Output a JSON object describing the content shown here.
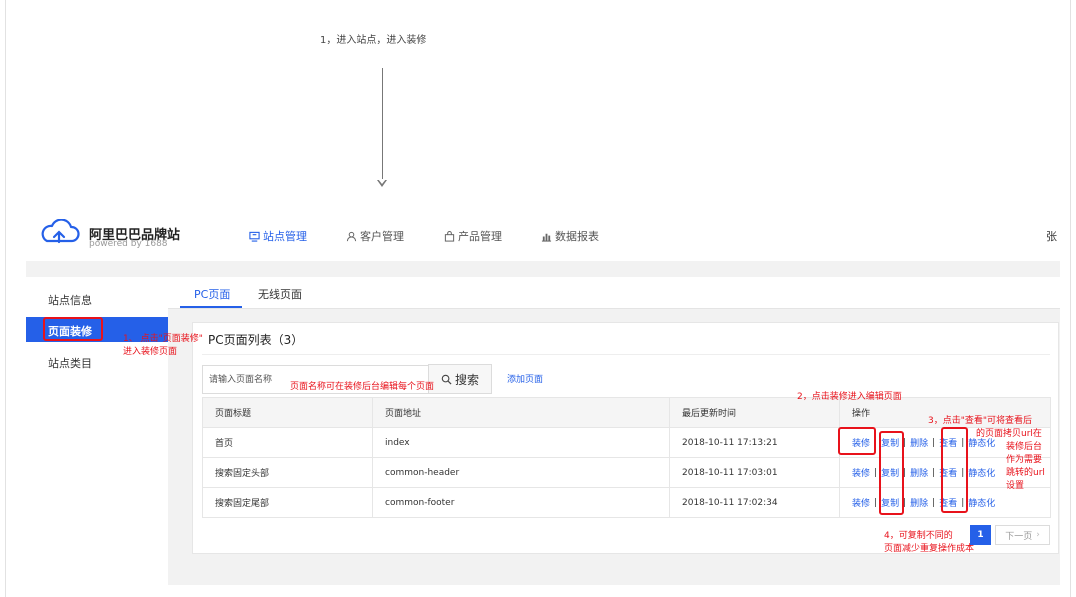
{
  "annotations": {
    "step1": "1，进入站点，进入装修",
    "step1_callout_line1": "1、 点击\"页面装修\"",
    "step1_callout_line2": "进入装修页面",
    "name_note": "页面名称可在装修后台编辑每个页面",
    "step2": "2，点击装修进入编辑页面",
    "step3_l1": "3，点击\"查看\"可将查看后",
    "step3_l2": "的页面拷贝url在",
    "step3_l3": "装修后台",
    "step3_l4": "作为需要",
    "step3_l5": "跳转的url",
    "step3_l6": "设置",
    "step4_l1": "4，可复制不同的",
    "step4_l2": "页面减少重复操作成本"
  },
  "header": {
    "brand_name": "阿里巴巴品牌站",
    "brand_sub": "powered by 1688",
    "nav": [
      {
        "label": "站点管理",
        "icon": "monitor-icon",
        "active": true
      },
      {
        "label": "客户管理",
        "icon": "user-icon",
        "active": false
      },
      {
        "label": "产品管理",
        "icon": "bag-icon",
        "active": false
      },
      {
        "label": "数据报表",
        "icon": "bar-chart-icon",
        "active": false
      }
    ],
    "user_name": "张"
  },
  "sidebar": {
    "items": [
      {
        "label": "站点信息",
        "active": false
      },
      {
        "label": "页面装修",
        "active": true
      },
      {
        "label": "站点类目",
        "active": false
      }
    ]
  },
  "tabs": [
    {
      "label": "PC页面",
      "active": true
    },
    {
      "label": "无线页面",
      "active": false
    }
  ],
  "panel": {
    "title": "PC页面列表（3）",
    "search_placeholder": "请输入页面名称",
    "search_button": "搜索",
    "add_page": "添加页面"
  },
  "table": {
    "columns": [
      "页面标题",
      "页面地址",
      "最后更新时间",
      "操作"
    ],
    "rows": [
      {
        "title": "首页",
        "address": "index",
        "updated": "2018-10-11 17:13:21"
      },
      {
        "title": "搜索固定头部",
        "address": "common-header",
        "updated": "2018-10-11 17:03:01"
      },
      {
        "title": "搜索固定尾部",
        "address": "common-footer",
        "updated": "2018-10-11 17:02:34"
      }
    ],
    "actions": [
      "装修",
      "复制",
      "删除",
      "查看",
      "静态化"
    ],
    "separator": "|"
  },
  "pagination": {
    "current": "1",
    "next": "下一页"
  },
  "colors": {
    "accent": "#2560e8",
    "annotation": "#e8121b"
  }
}
